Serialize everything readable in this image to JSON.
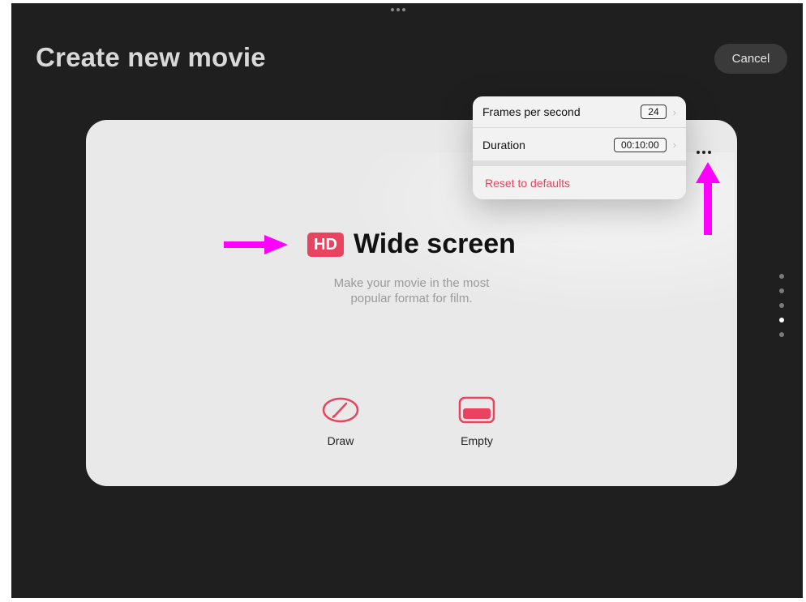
{
  "window": {
    "title": "Create new movie"
  },
  "toolbar": {
    "cancel_label": "Cancel"
  },
  "card": {
    "badge": "HD",
    "title": "Wide screen",
    "description_line1": "Make your movie in the most",
    "description_line2": "popular format for film."
  },
  "options": [
    {
      "label": "Draw",
      "icon": "brush-icon"
    },
    {
      "label": "Empty",
      "icon": "empty-frame-icon"
    }
  ],
  "menu": {
    "fps_label": "Frames per second",
    "fps_value": "24",
    "duration_label": "Duration",
    "duration_value": "00:10:00",
    "reset_label": "Reset to defaults"
  },
  "pager": {
    "count": 5,
    "active_index": 3
  },
  "colors": {
    "accent": "#e8435f",
    "annotation": "#ff00ff",
    "background": "#1f1f1f",
    "card": "#e9e9e9"
  }
}
